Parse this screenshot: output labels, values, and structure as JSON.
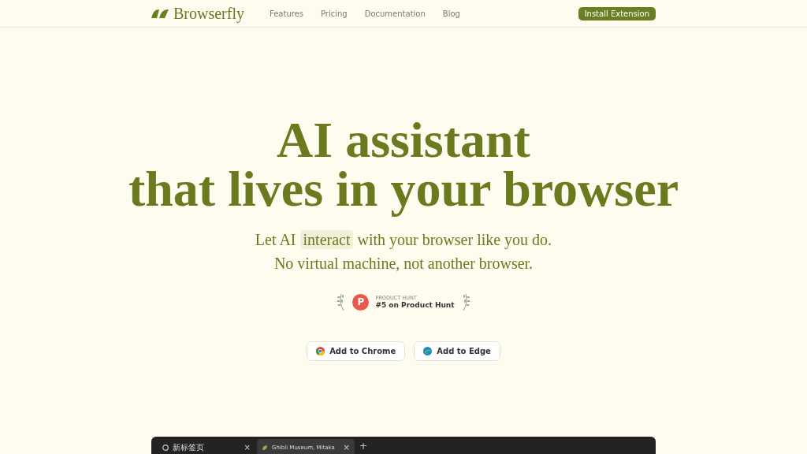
{
  "nav": {
    "brand": "Browserfly",
    "links": [
      "Features",
      "Pricing",
      "Documentation",
      "Blog"
    ],
    "cta": "Install Extension"
  },
  "hero": {
    "title_lines": [
      "AI assistant",
      "that lives in your browser"
    ],
    "subtitle_before": "Let AI",
    "subtitle_highlight": "interact",
    "subtitle_after": "with your browser like you do.",
    "subtitle_line2": "No virtual machine, not another browser."
  },
  "badge": {
    "kicker": "PRODUCT HUNT",
    "text": "#5 on Product Hunt",
    "letter": "P"
  },
  "buttons": [
    {
      "label": "Add to Chrome",
      "kind": "chrome"
    },
    {
      "label": "Add to Edge",
      "kind": "edge"
    }
  ],
  "browser": {
    "tabs": [
      {
        "title": "新标签页",
        "close": "×",
        "selected": false
      },
      {
        "title": "Ghibli Museum, Mitaka",
        "close": "×",
        "selected": true
      }
    ],
    "new_tab": "+"
  }
}
